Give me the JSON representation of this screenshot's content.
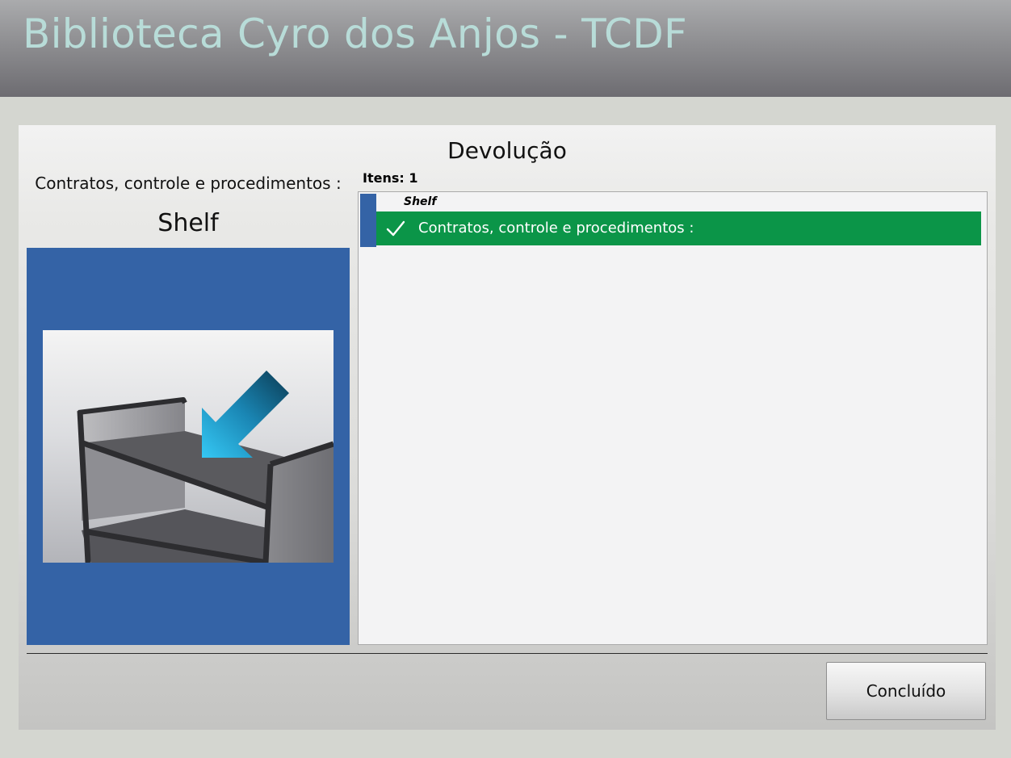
{
  "header": {
    "title": "Biblioteca Cyro dos Anjos - TCDF"
  },
  "panel": {
    "title": "Devolução"
  },
  "item": {
    "label": "Contratos, controle e procedimentos :",
    "location_type": "Shelf",
    "image_icon": "shelf-return-illustration"
  },
  "items_list": {
    "count_label": "Itens: 1",
    "groups": [
      {
        "header": "Shelf",
        "rows": [
          {
            "label": "Contratos, controle e procedimentos :",
            "status_icon": "check-icon",
            "status_color": "#0b9548"
          }
        ]
      }
    ]
  },
  "footer": {
    "done_label": "Concluído"
  },
  "colors": {
    "accent_blue": "#3463a6",
    "success_green": "#0b9548",
    "header_text": "#b8dcd8"
  }
}
